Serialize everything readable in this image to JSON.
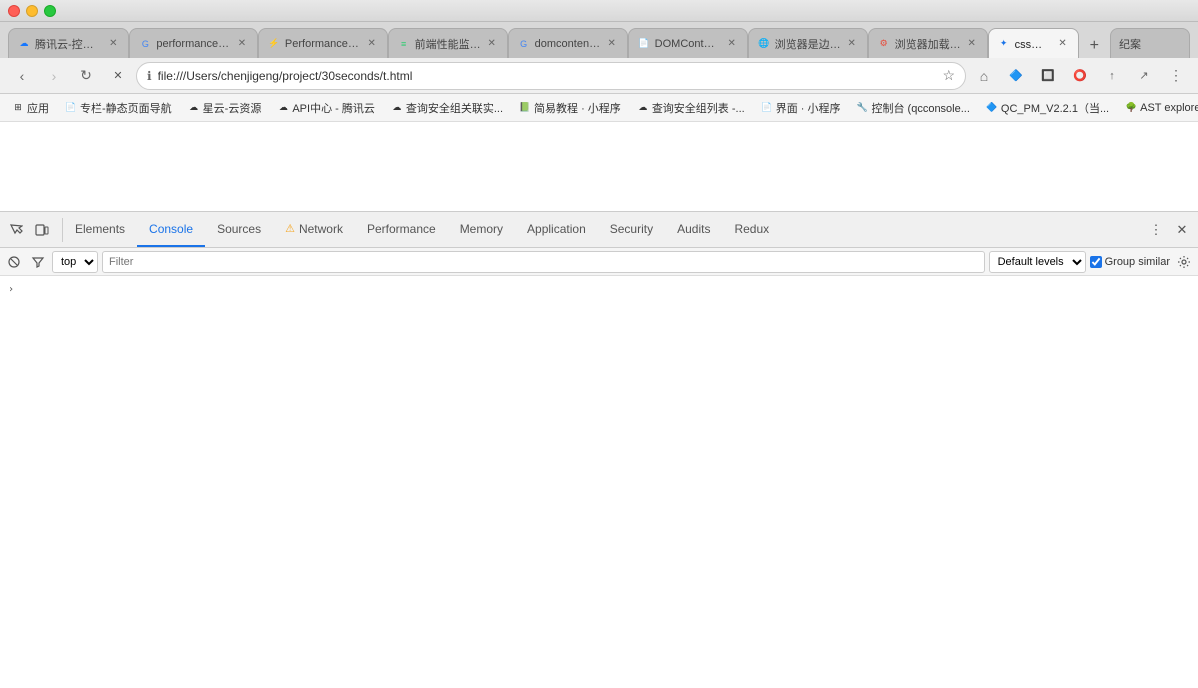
{
  "window": {
    "title": "css阻塞"
  },
  "tabs": [
    {
      "id": "tab-tencent",
      "label": "腾讯云-控制台",
      "favicon": "☁",
      "favicon_color": "#1677ff",
      "active": false
    },
    {
      "id": "tab-perf1",
      "label": "performance.t...",
      "favicon": "G",
      "favicon_color": "#4285f4",
      "active": false
    },
    {
      "id": "tab-perf2",
      "label": "Performance.t...",
      "favicon": "⚡",
      "favicon_color": "#e67e22",
      "active": false
    },
    {
      "id": "tab-monitor",
      "label": "前端性能监控...",
      "favicon": "≡",
      "favicon_color": "#2ecc71",
      "active": false
    },
    {
      "id": "tab-domcontent1",
      "label": "domcontentloa...",
      "favicon": "G",
      "favicon_color": "#4285f4",
      "active": false
    },
    {
      "id": "tab-domcontent2",
      "label": "DOMContentL...",
      "favicon": "📄",
      "favicon_color": "#555",
      "active": false
    },
    {
      "id": "tab-browser1",
      "label": "浏览器是边解析...",
      "favicon": "🌐",
      "favicon_color": "#555",
      "active": false
    },
    {
      "id": "tab-browser2",
      "label": "浏览器加载、解...",
      "favicon": "⚙",
      "favicon_color": "#e74c3c",
      "active": false
    },
    {
      "id": "tab-css",
      "label": "css阻塞",
      "favicon": "✦",
      "favicon_color": "#1a73e8",
      "active": true
    },
    {
      "id": "tab-new",
      "label": "纪案",
      "favicon": "",
      "favicon_color": "#555",
      "active": false
    }
  ],
  "toolbar": {
    "back_disabled": false,
    "forward_disabled": false,
    "reload_label": "↻",
    "address": "file:///Users/chenjigeng/project/30seconds/t.html",
    "star_icon": "☆",
    "extensions": [
      "🔷",
      "🔲",
      "⭕",
      "↑",
      "↗"
    ],
    "menu_icon": "⋮"
  },
  "bookmarks": [
    {
      "label": "应用",
      "favicon": "⊞"
    },
    {
      "label": "专栏-静态页面导航",
      "favicon": "📄"
    },
    {
      "label": "星云-云资源",
      "favicon": "☁"
    },
    {
      "label": "API中心 - 腾讯云",
      "favicon": "☁"
    },
    {
      "label": "查询安全组关联实...",
      "favicon": "☁"
    },
    {
      "label": "简易教程 · 小程序",
      "favicon": "📗"
    },
    {
      "label": "查询安全组列表 -...",
      "favicon": "☁"
    },
    {
      "label": "界面 · 小程序",
      "favicon": "📄"
    },
    {
      "label": "控制台 (qcconsole...",
      "favicon": "🔧"
    },
    {
      "label": "QC_PM_V2.2.1（当...",
      "favicon": "🔷"
    },
    {
      "label": "AST explorer",
      "favicon": "🌳"
    }
  ],
  "devtools": {
    "tabs": [
      {
        "id": "elements",
        "label": "Elements",
        "active": false,
        "warning": false
      },
      {
        "id": "console",
        "label": "Console",
        "active": true,
        "warning": false
      },
      {
        "id": "sources",
        "label": "Sources",
        "active": false,
        "warning": false
      },
      {
        "id": "network",
        "label": "Network",
        "active": false,
        "warning": true
      },
      {
        "id": "performance",
        "label": "Performance",
        "active": false,
        "warning": false
      },
      {
        "id": "memory",
        "label": "Memory",
        "active": false,
        "warning": false
      },
      {
        "id": "application",
        "label": "Application",
        "active": false,
        "warning": false
      },
      {
        "id": "security",
        "label": "Security",
        "active": false,
        "warning": false
      },
      {
        "id": "audits",
        "label": "Audits",
        "active": false,
        "warning": false
      },
      {
        "id": "redux",
        "label": "Redux",
        "active": false,
        "warning": false
      }
    ],
    "console": {
      "context": "top",
      "filter_placeholder": "Filter",
      "levels_label": "Default levels",
      "group_similar_label": "Group similar",
      "group_similar_checked": true
    }
  }
}
